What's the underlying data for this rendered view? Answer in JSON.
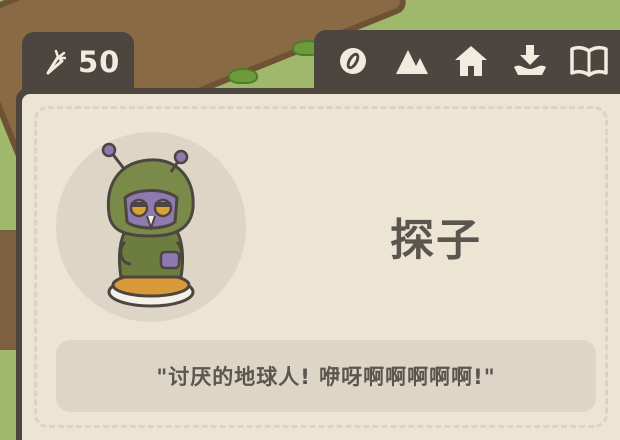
{
  "carrots": {
    "icon": "carrot-icon",
    "count": "50"
  },
  "toolbar": {
    "items": [
      {
        "icon": "seed-icon"
      },
      {
        "icon": "tent-icon"
      },
      {
        "icon": "home-icon"
      },
      {
        "icon": "download-collect-icon"
      },
      {
        "icon": "book-icon"
      }
    ]
  },
  "character": {
    "name": "探子",
    "portrait": "hooded-figure-portrait",
    "quote": "\"讨厌的地球人! 咿呀啊啊啊啊啊!\""
  },
  "colors": {
    "frame": "#4d4540",
    "card": "#ede5d3",
    "panel": "#ddd6c6",
    "text": "#5b5550",
    "icon": "#f2ece0"
  }
}
